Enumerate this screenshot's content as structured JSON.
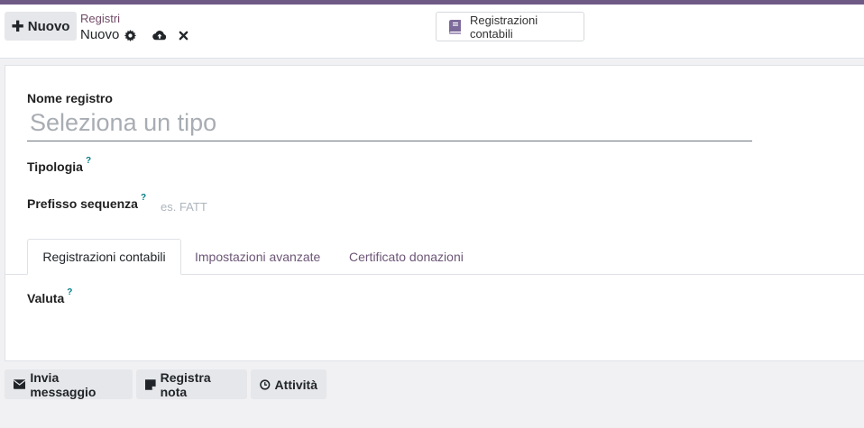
{
  "control_panel": {
    "new_button": "Nuovo",
    "breadcrumb_parent": "Registri",
    "breadcrumb_current": "Nuovo",
    "stat_button_label": "Registrazioni contabili"
  },
  "form": {
    "name_label": "Nome registro",
    "name_placeholder": "Seleziona un tipo",
    "type_label": "Tipologia",
    "prefix_label": "Prefisso sequenza",
    "prefix_placeholder": "es. FATT",
    "help_mark": "?"
  },
  "tabs": [
    {
      "label": "Registrazioni contabili",
      "active": true
    },
    {
      "label": "Impostazioni avanzate",
      "active": false
    },
    {
      "label": "Certificato donazioni",
      "active": false
    }
  ],
  "tab_content": {
    "currency_label": "Valuta"
  },
  "chatter": {
    "send_message": "Invia messaggio",
    "log_note": "Registra nota",
    "activity": "Attività"
  },
  "colors": {
    "brand": "#714b67",
    "topbar": "#6f5a86",
    "help": "#017e84"
  }
}
